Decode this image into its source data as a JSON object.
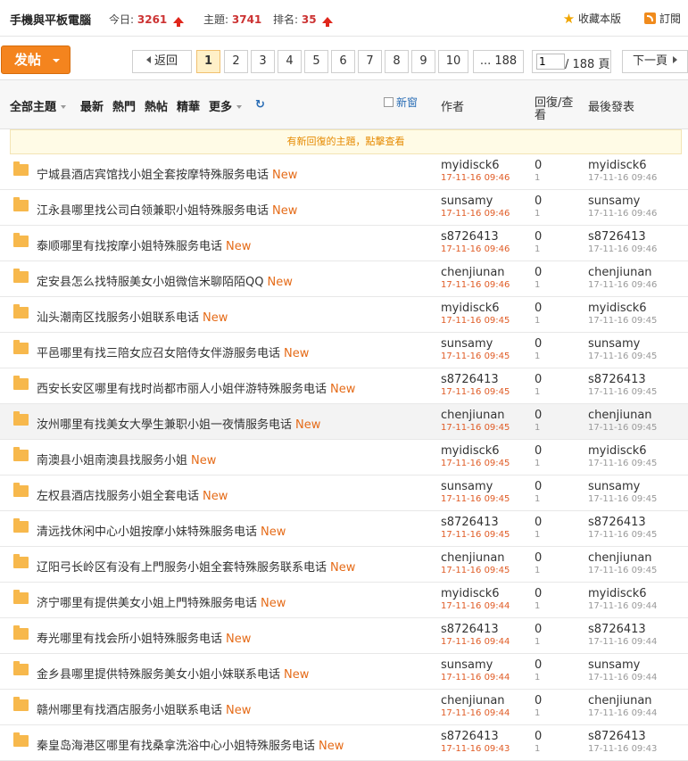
{
  "header": {
    "forum_name": "手機與平板電腦",
    "today_label": "今日:",
    "today_count": "3261",
    "topics_label": "主題:",
    "topics_count": "3741",
    "rank_label": "排名:",
    "rank_value": "35",
    "favorite_label": "收藏本版",
    "subscribe_label": "訂閱"
  },
  "toolbar": {
    "post_label": "发帖",
    "back_label": "返回",
    "pages": [
      "1",
      "2",
      "3",
      "4",
      "5",
      "6",
      "7",
      "8",
      "9",
      "10"
    ],
    "current_page": "1",
    "last_page_label": "... 188",
    "page_input_value": "1",
    "page_total_label": "/ 188 頁",
    "next_label": "下一頁"
  },
  "table_header": {
    "all_topics": "全部主題",
    "latest": "最新",
    "hot": "熱門",
    "hot_posts": "熱帖",
    "digest": "精華",
    "more": "更多",
    "new_window": "新窗",
    "author": "作者",
    "replies_views": "回復/查看",
    "last_post": "最後發表"
  },
  "notice": "有新回復的主題，點擊查看",
  "new_tag": "New",
  "icons": {
    "rank_arrow": "up-arrow-icon",
    "favorite": "star-icon",
    "subscribe": "rss-icon",
    "refresh": "refresh-icon",
    "folder": "folder-icon"
  },
  "colors": {
    "accent": "#f4841e",
    "number": "#cc3333",
    "new_tag": "#e56b18",
    "date": "#e05c26"
  },
  "threads": [
    {
      "title": "宁城县酒店宾馆找小姐全套按摩特殊服务电话",
      "author": "myidisck6",
      "date": "17-11-16 09:46",
      "replies": "0",
      "views": "1",
      "last_user": "myidisck6",
      "last_date": "17-11-16 09:46"
    },
    {
      "title": "江永县哪里找公司白领兼职小姐特殊服务电话",
      "author": "sunsamy",
      "date": "17-11-16 09:46",
      "replies": "0",
      "views": "1",
      "last_user": "sunsamy",
      "last_date": "17-11-16 09:46"
    },
    {
      "title": "泰顺哪里有找按摩小姐特殊服务电话",
      "author": "s8726413",
      "date": "17-11-16 09:46",
      "replies": "0",
      "views": "1",
      "last_user": "s8726413",
      "last_date": "17-11-16 09:46"
    },
    {
      "title": "定安县怎么找特服美女小姐微信米聊陌陌QQ",
      "author": "chenjiunan",
      "date": "17-11-16 09:46",
      "replies": "0",
      "views": "1",
      "last_user": "chenjiunan",
      "last_date": "17-11-16 09:46"
    },
    {
      "title": "汕头潮南区找服务小姐联系电话",
      "author": "myidisck6",
      "date": "17-11-16 09:45",
      "replies": "0",
      "views": "1",
      "last_user": "myidisck6",
      "last_date": "17-11-16 09:45"
    },
    {
      "title": "平邑哪里有找三陪女应召女陪侍女伴游服务电话",
      "author": "sunsamy",
      "date": "17-11-16 09:45",
      "replies": "0",
      "views": "1",
      "last_user": "sunsamy",
      "last_date": "17-11-16 09:45"
    },
    {
      "title": "西安长安区哪里有找时尚都市丽人小姐伴游特殊服务电话",
      "author": "s8726413",
      "date": "17-11-16 09:45",
      "replies": "0",
      "views": "1",
      "last_user": "s8726413",
      "last_date": "17-11-16 09:45"
    },
    {
      "title": "汝州哪里有找美女大學生兼职小姐一夜情服务电话",
      "author": "chenjiunan",
      "date": "17-11-16 09:45",
      "replies": "0",
      "views": "1",
      "last_user": "chenjiunan",
      "last_date": "17-11-16 09:45"
    },
    {
      "title": "南澳县小姐南澳县找服务小姐",
      "author": "myidisck6",
      "date": "17-11-16 09:45",
      "replies": "0",
      "views": "1",
      "last_user": "myidisck6",
      "last_date": "17-11-16 09:45"
    },
    {
      "title": "左权县酒店找服务小姐全套电话",
      "author": "sunsamy",
      "date": "17-11-16 09:45",
      "replies": "0",
      "views": "1",
      "last_user": "sunsamy",
      "last_date": "17-11-16 09:45"
    },
    {
      "title": "清远找休闲中心小姐按摩小妹特殊服务电话",
      "author": "s8726413",
      "date": "17-11-16 09:45",
      "replies": "0",
      "views": "1",
      "last_user": "s8726413",
      "last_date": "17-11-16 09:45"
    },
    {
      "title": "辽阳弓长岭区有没有上門服务小姐全套特殊服务联系电话",
      "author": "chenjiunan",
      "date": "17-11-16 09:45",
      "replies": "0",
      "views": "1",
      "last_user": "chenjiunan",
      "last_date": "17-11-16 09:45"
    },
    {
      "title": "济宁哪里有提供美女小姐上門特殊服务电话",
      "author": "myidisck6",
      "date": "17-11-16 09:44",
      "replies": "0",
      "views": "1",
      "last_user": "myidisck6",
      "last_date": "17-11-16 09:44"
    },
    {
      "title": "寿光哪里有找会所小姐特殊服务电话",
      "author": "s8726413",
      "date": "17-11-16 09:44",
      "replies": "0",
      "views": "1",
      "last_user": "s8726413",
      "last_date": "17-11-16 09:44"
    },
    {
      "title": "金乡县哪里提供特殊服务美女小姐小妹联系电话",
      "author": "sunsamy",
      "date": "17-11-16 09:44",
      "replies": "0",
      "views": "1",
      "last_user": "sunsamy",
      "last_date": "17-11-16 09:44"
    },
    {
      "title": "赣州哪里有找酒店服务小姐联系电话",
      "author": "chenjiunan",
      "date": "17-11-16 09:44",
      "replies": "0",
      "views": "1",
      "last_user": "chenjiunan",
      "last_date": "17-11-16 09:44"
    },
    {
      "title": "秦皇岛海港区哪里有找桑拿洗浴中心小姐特殊服务电话",
      "author": "s8726413",
      "date": "17-11-16 09:43",
      "replies": "0",
      "views": "1",
      "last_user": "s8726413",
      "last_date": "17-11-16 09:43"
    }
  ]
}
